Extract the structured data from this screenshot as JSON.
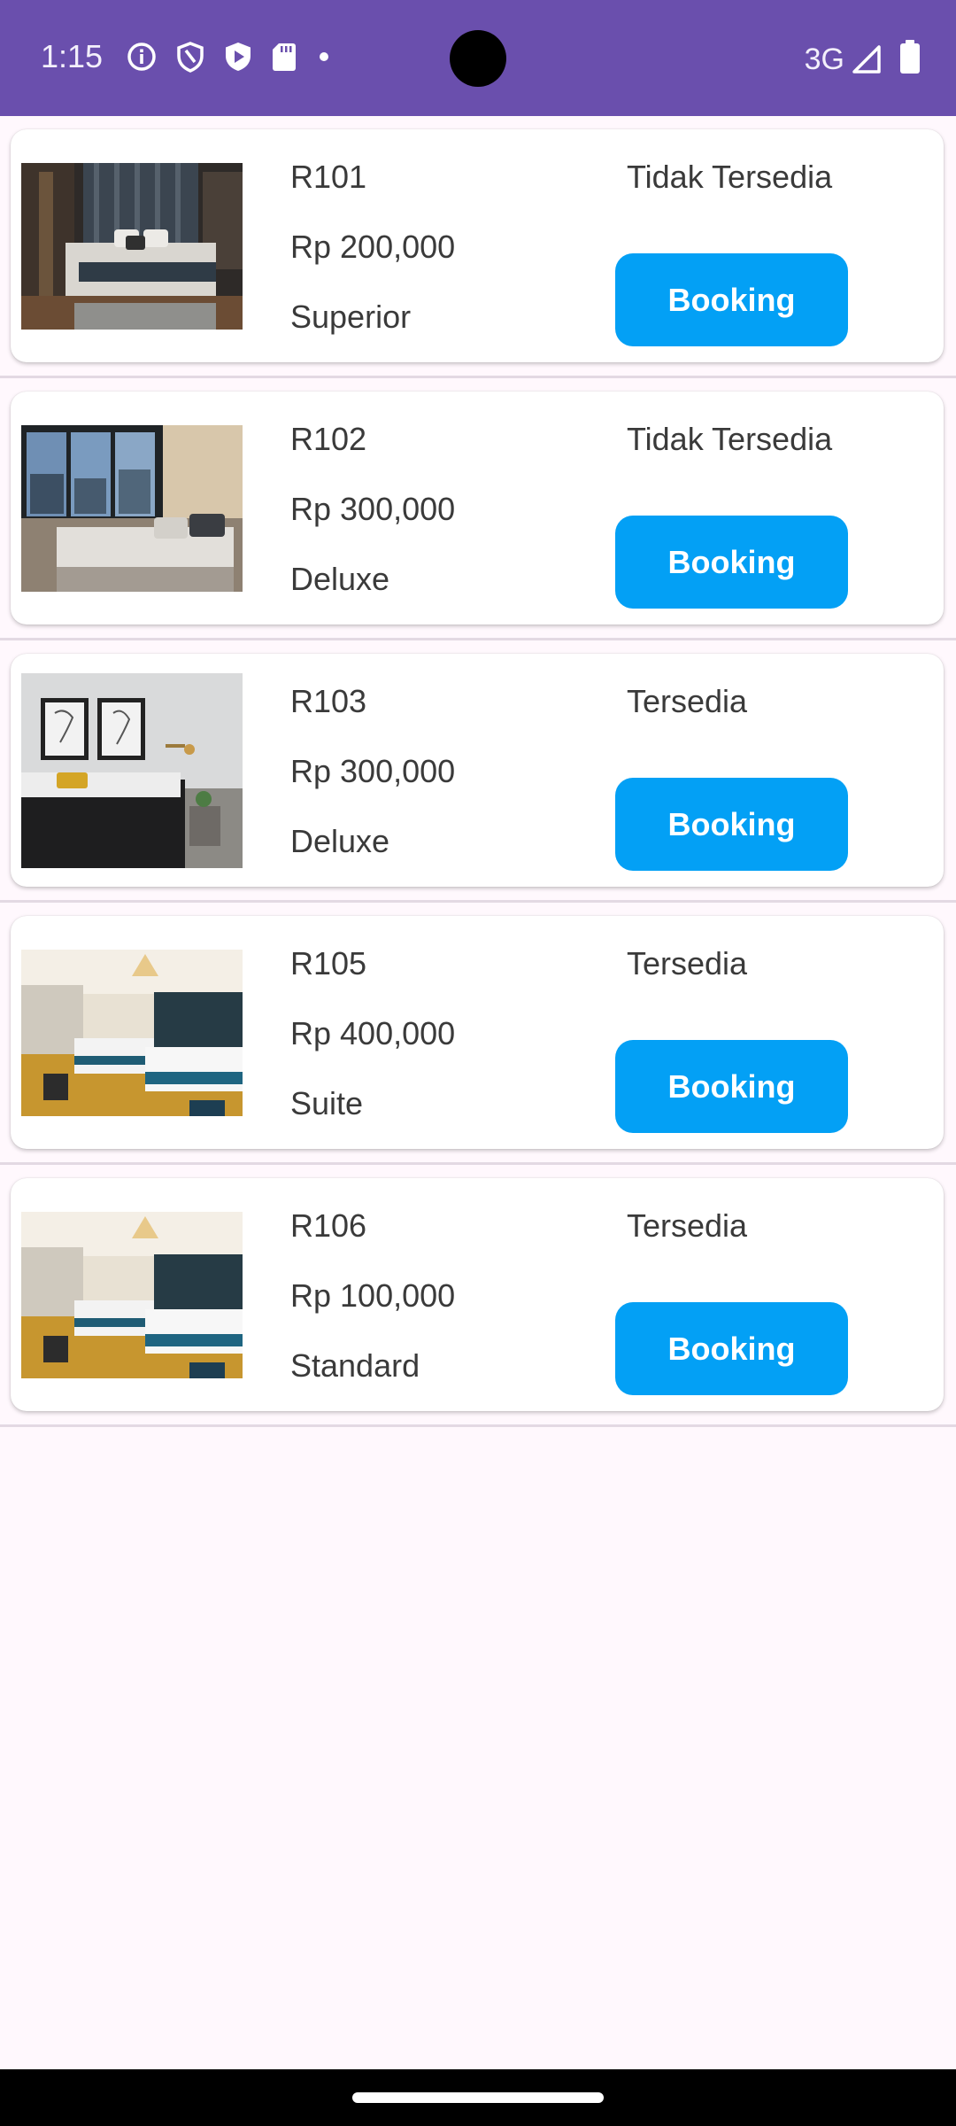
{
  "status_bar": {
    "time": "1:15",
    "network": "3G",
    "icons_left": [
      "info-icon",
      "shield-icon",
      "play-protect-icon",
      "sd-card-icon",
      "dot-icon"
    ],
    "icons_right": [
      "signal-icon",
      "battery-icon"
    ],
    "background_color": "#6A4FAD"
  },
  "rooms": [
    {
      "number": "R101",
      "price": "Rp 200,000",
      "type": "Superior",
      "status": "Tidak Tersedia",
      "button_label": "Booking"
    },
    {
      "number": "R102",
      "price": "Rp 300,000",
      "type": "Deluxe",
      "status": "Tidak Tersedia",
      "button_label": "Booking"
    },
    {
      "number": "R103",
      "price": "Rp 300,000",
      "type": "Deluxe",
      "status": "Tersedia",
      "button_label": "Booking"
    },
    {
      "number": "R105",
      "price": "Rp 400,000",
      "type": "Suite",
      "status": "Tersedia",
      "button_label": "Booking"
    },
    {
      "number": "R106",
      "price": "Rp 100,000",
      "type": "Standard",
      "status": "Tersedia",
      "button_label": "Booking"
    }
  ],
  "colors": {
    "accent_button": "#03A0F5",
    "page_background": "#FFF8FD",
    "card_background": "#FFFFFF"
  }
}
